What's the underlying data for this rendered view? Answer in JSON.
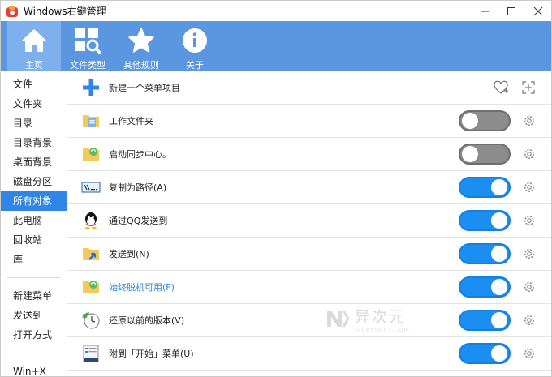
{
  "window": {
    "title": "Windows右键管理"
  },
  "toolbar": {
    "items": [
      {
        "label": "主页",
        "icon": "home-icon",
        "active": true
      },
      {
        "label": "文件类型",
        "icon": "file-types-icon",
        "active": false
      },
      {
        "label": "其他规则",
        "icon": "star-icon",
        "active": false
      },
      {
        "label": "关于",
        "icon": "info-icon",
        "active": false
      }
    ]
  },
  "sidebar": {
    "items": [
      "文件",
      "文件夹",
      "目录",
      "目录背景",
      "桌面背景",
      "磁盘分区",
      "所有对象",
      "此电脑",
      "回收站",
      "库"
    ],
    "items2": [
      "新建菜单",
      "发送到",
      "打开方式"
    ],
    "items3": [
      "Win+X"
    ],
    "active": "所有对象"
  },
  "content": {
    "new_item_label": "新建一个菜单项目",
    "rows": [
      {
        "label": "工作文件夹",
        "icon": "work-folder-icon",
        "enabled": false,
        "link": false
      },
      {
        "label": "启动同步中心。",
        "icon": "sync-center-icon",
        "enabled": false,
        "link": false
      },
      {
        "label": "复制为路径(A)",
        "icon": "copy-path-icon",
        "enabled": true,
        "link": false
      },
      {
        "label": "通过QQ发送到",
        "icon": "qq-icon",
        "enabled": true,
        "link": false
      },
      {
        "label": "发送到(N)",
        "icon": "send-to-icon",
        "enabled": true,
        "link": false
      },
      {
        "label": "始终脱机可用(F)",
        "icon": "offline-icon",
        "enabled": true,
        "link": true
      },
      {
        "label": "还原以前的版本(V)",
        "icon": "restore-icon",
        "enabled": true,
        "link": false
      },
      {
        "label": "附到「开始」菜单(U)",
        "icon": "pin-start-icon",
        "enabled": true,
        "link": false
      }
    ]
  },
  "watermark": {
    "main": "异次元",
    "sub": "IPLAYSOFT.COM"
  },
  "colors": {
    "toolbar": "#5b96e0",
    "accent": "#2f86e6",
    "toggle_on": "#1b8ef2",
    "toggle_off": "#8c8c8c"
  }
}
